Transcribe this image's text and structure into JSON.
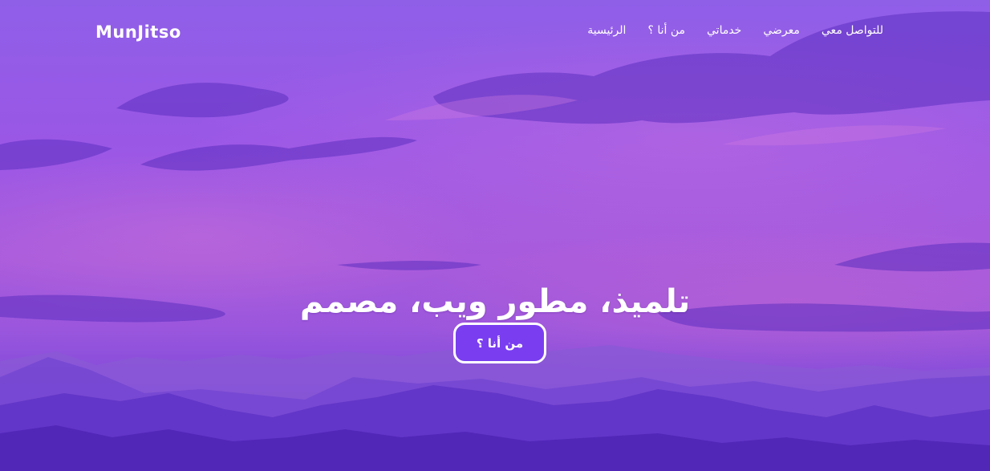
{
  "brand": {
    "logo_text": "MunJitso"
  },
  "nav": {
    "items": [
      {
        "label": "الرئيسية"
      },
      {
        "label": "من أنا ؟"
      },
      {
        "label": "خدماتي"
      },
      {
        "label": "معرضي"
      },
      {
        "label": "للتواصل معي"
      }
    ]
  },
  "hero": {
    "headline": "تلميذ، مطور ويب، مصمم",
    "cta_label": "من أنا ؟"
  },
  "colors": {
    "sky_top": "#8f5fe8",
    "sky_mid": "#a85bdc",
    "mountain_far": "#8a5ad6",
    "mountain_near": "#5a2fc0",
    "cta_background": "#7a3ef0",
    "text": "#ffffff"
  }
}
